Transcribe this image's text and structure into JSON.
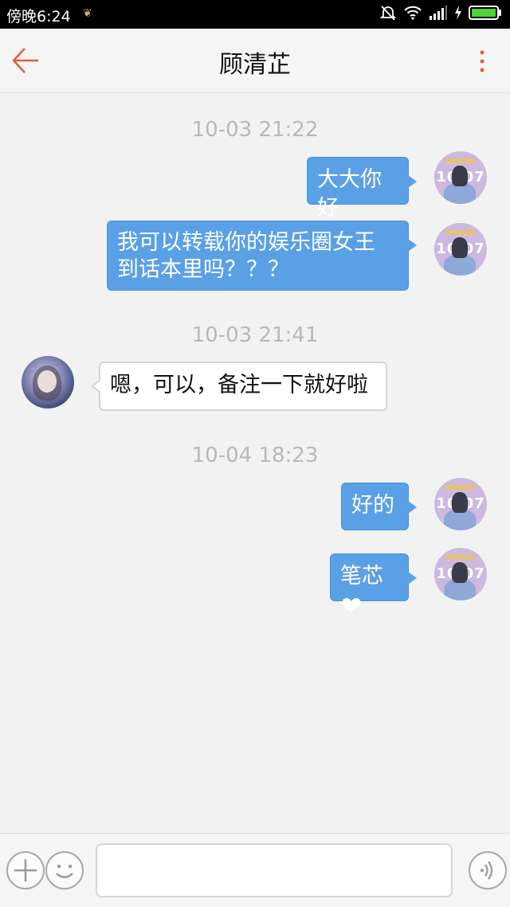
{
  "status_bar": {
    "time": "傍晚6:24"
  },
  "header": {
    "back_icon": "arrow-left-icon",
    "title": "顾清芷",
    "menu_icon": "more-vertical-icon"
  },
  "messages": [
    {
      "timestamp": "10-03 21:22"
    },
    {
      "from": "me",
      "text": "大大你好"
    },
    {
      "from": "me",
      "lines": [
        "我可以转载你的娱乐圈女王",
        "到话本里吗？？？"
      ]
    },
    {
      "timestamp": "10-03 21:41"
    },
    {
      "from": "other",
      "text": "嗯，可以，备注一下就好啦"
    },
    {
      "timestamp": "10-04 18:23"
    },
    {
      "from": "me",
      "text": "好的"
    },
    {
      "from": "me",
      "text": "笔芯",
      "emoji": "heart-icon"
    }
  ],
  "my_avatar_text": "10 07",
  "input_bar": {
    "add_icon": "plus-circle-icon",
    "emoji_icon": "smiley-icon",
    "input_value": "",
    "voice_icon": "voice-icon"
  },
  "colors": {
    "accent": "#e0603a",
    "bubble_out": "#5aa0e6",
    "timestamp": "#b9b9b9"
  }
}
